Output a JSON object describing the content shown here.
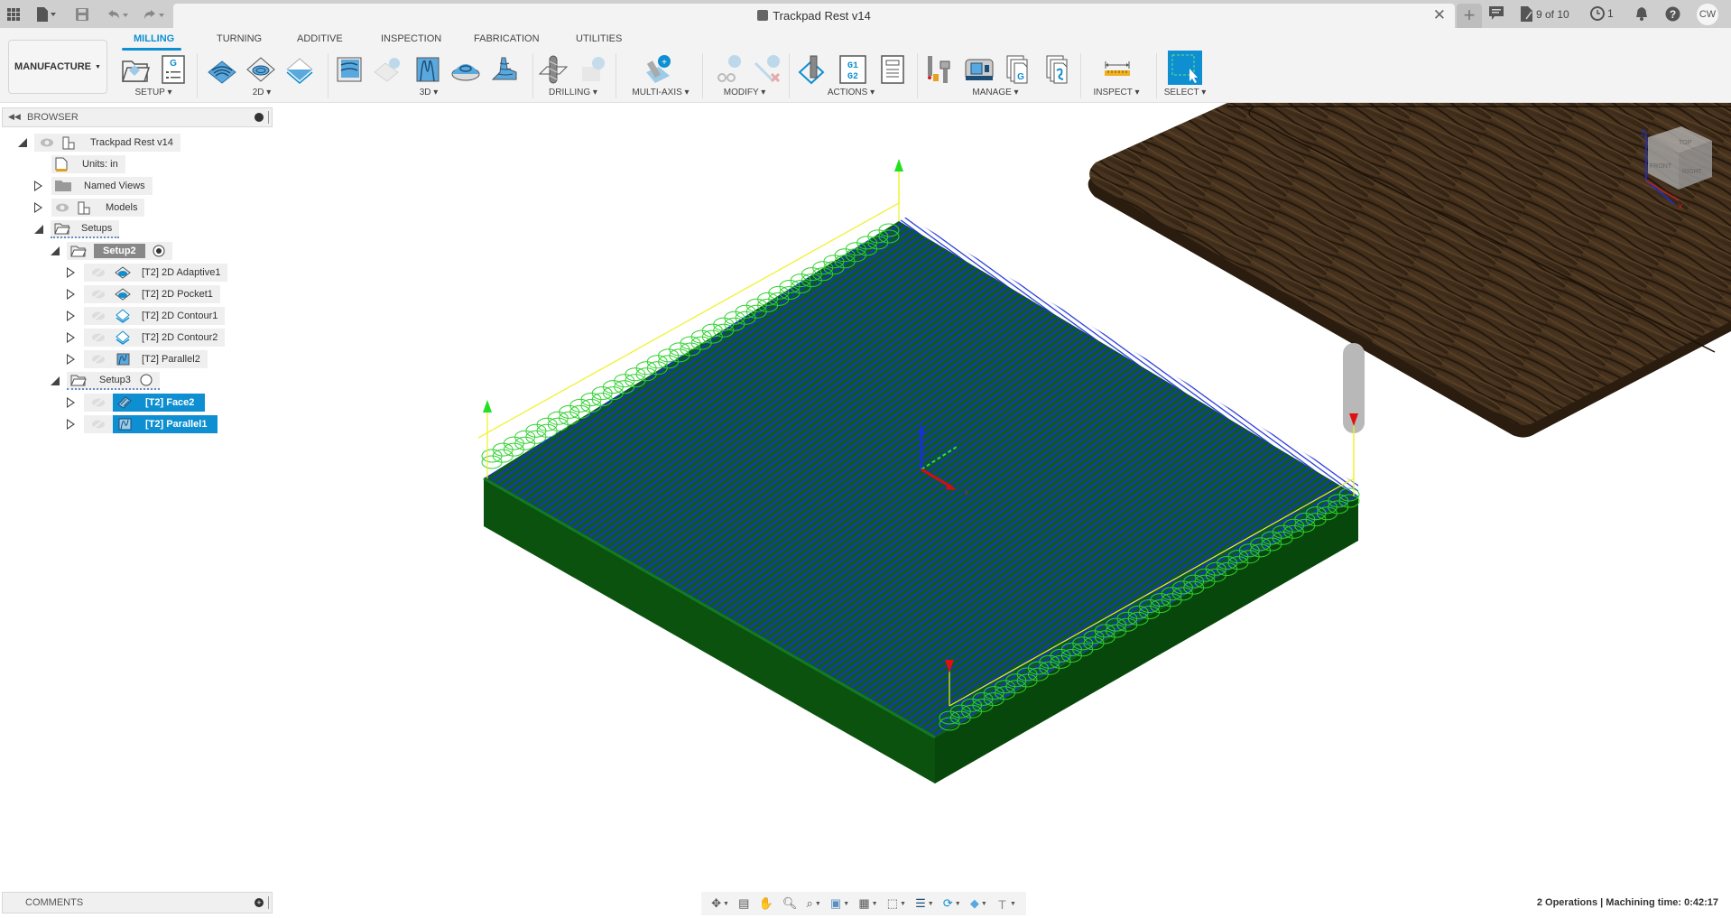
{
  "titlebar": {
    "document_title": "Trackpad Rest v14",
    "icons": [
      "apps-grid-icon",
      "file-icon",
      "save-icon",
      "undo-icon",
      "redo-icon"
    ],
    "jobs_status": "9 of 10",
    "notifications_count": "1",
    "user_initials": "CW"
  },
  "ribbon": {
    "workspace": "MANUFACTURE",
    "tabs": [
      {
        "label": "MILLING",
        "active": true
      },
      {
        "label": "TURNING",
        "active": false
      },
      {
        "label": "ADDITIVE",
        "active": false
      },
      {
        "label": "INSPECTION",
        "active": false
      },
      {
        "label": "FABRICATION",
        "active": false
      },
      {
        "label": "UTILITIES",
        "active": false
      }
    ],
    "groups": [
      {
        "label": "SETUP",
        "icons": [
          "new-setup-icon",
          "nc-program-icon"
        ]
      },
      {
        "label": "2D",
        "icons": [
          "2d-adaptive-icon",
          "2d-pocket-icon",
          "2d-contour-icon"
        ]
      },
      {
        "label": "3D",
        "icons": [
          "3d-adaptive-icon",
          "3d-pocket-disabled-icon",
          "parallel-icon",
          "contour-3d-icon",
          "scallop-icon"
        ]
      },
      {
        "label": "DRILLING",
        "icons": [
          "drill-icon",
          "drill-disabled-icon"
        ]
      },
      {
        "label": "MULTI-AXIS",
        "icons": [
          "multi-axis-icon"
        ]
      },
      {
        "label": "MODIFY",
        "icons": [
          "modify-cut-icon",
          "modify-delete-icon"
        ]
      },
      {
        "label": "ACTIONS",
        "icons": [
          "simulate-icon",
          "post-process-icon",
          "setup-sheet-icon"
        ]
      },
      {
        "label": "MANAGE",
        "icons": [
          "tool-library-icon",
          "machine-library-icon",
          "post-library-icon",
          "template-library-icon"
        ]
      },
      {
        "label": "INSPECT",
        "icons": [
          "measure-icon"
        ]
      },
      {
        "label": "SELECT",
        "icons": [
          "select-window-icon"
        ]
      }
    ]
  },
  "browser": {
    "title": "BROWSER",
    "items": [
      {
        "label": "Trackpad Rest v14",
        "level": 0,
        "expanded": true
      },
      {
        "label": "Units: in",
        "level": 1
      },
      {
        "label": "Named Views",
        "level": 1,
        "expanded": false
      },
      {
        "label": "Models",
        "level": 1,
        "expanded": false
      },
      {
        "label": "Setups",
        "level": 1,
        "expanded": true
      },
      {
        "label": "Setup2",
        "level": 2,
        "expanded": true,
        "active": true
      },
      {
        "label": "[T2] 2D Adaptive1",
        "level": 3
      },
      {
        "label": "[T2] 2D Pocket1",
        "level": 3
      },
      {
        "label": "[T2] 2D Contour1",
        "level": 3
      },
      {
        "label": "[T2] 2D Contour2",
        "level": 3
      },
      {
        "label": "[T2] Parallel2",
        "level": 3
      },
      {
        "label": "Setup3",
        "level": 2,
        "expanded": true,
        "active": false
      },
      {
        "label": "[T2] Face2",
        "level": 3,
        "selected": true
      },
      {
        "label": "[T2] Parallel1",
        "level": 3,
        "selected": true
      }
    ]
  },
  "comments": {
    "title": "COMMENTS"
  },
  "navbar": {
    "items": [
      "orbit-icon",
      "look-at-icon",
      "pan-icon",
      "zoom-icon",
      "fit-icon",
      "display-settings-icon",
      "grid-icon",
      "view-cube-icon",
      "stock-icon",
      "refresh-icon",
      "toolpath-icon",
      "tool-icon"
    ]
  },
  "viewcube": {
    "top": "TOP",
    "front": "FRONT",
    "right": "RIGHT",
    "axis_z": "Z",
    "axis_x": "X"
  },
  "status": {
    "text": "2 Operations | Machining time: 0:42:17"
  },
  "colors": {
    "accent": "#0e8fd1",
    "stock": "#0b520f",
    "toolpath_blue": "#1a2fd6",
    "lead_green": "#2ed12e",
    "rapid_yellow": "#f0f020",
    "wood": "#3b2a1a"
  }
}
